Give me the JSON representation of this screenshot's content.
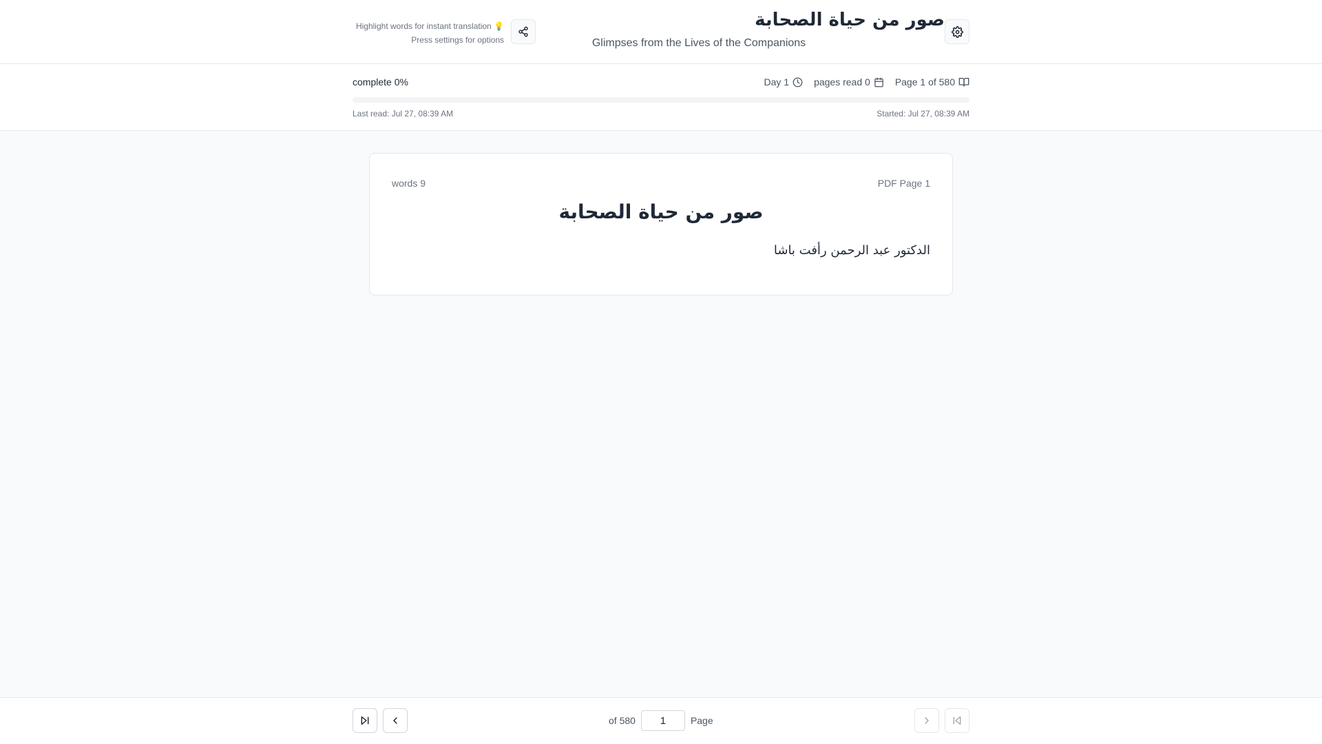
{
  "header": {
    "hint_line1": "Highlight words for instant translation 💡",
    "hint_line2": "Press settings for options",
    "title": "صور من حياة الصحابة",
    "subtitle": "Glimpses from the Lives of the Companions"
  },
  "progress": {
    "complete_label": "complete 0%",
    "percent": 0,
    "day_label": "Day 1",
    "pages_read_label": "pages read 0",
    "page_label": "Page 1 of 580",
    "last_read": "Last read: Jul 27, 08:39 AM",
    "started": "Started: Jul 27, 08:39 AM"
  },
  "card": {
    "word_count": "words 9",
    "pdf_page": "PDF Page 1",
    "title": "صور من حياة الصحابة",
    "author": "الدكتور عبد الرحمن رأفت باشا"
  },
  "footer": {
    "of_total": "of 580",
    "page_value": "1",
    "page_label": "Page"
  },
  "colors": {
    "accent": "#3b82f6",
    "text": "#1f2937",
    "muted": "#6b7280"
  },
  "icons": [
    "share-icon",
    "gear-icon",
    "clock-icon",
    "calendar-icon",
    "book-open-icon",
    "skip-end-icon",
    "chevron-left-icon",
    "chevron-right-icon",
    "skip-start-icon"
  ]
}
